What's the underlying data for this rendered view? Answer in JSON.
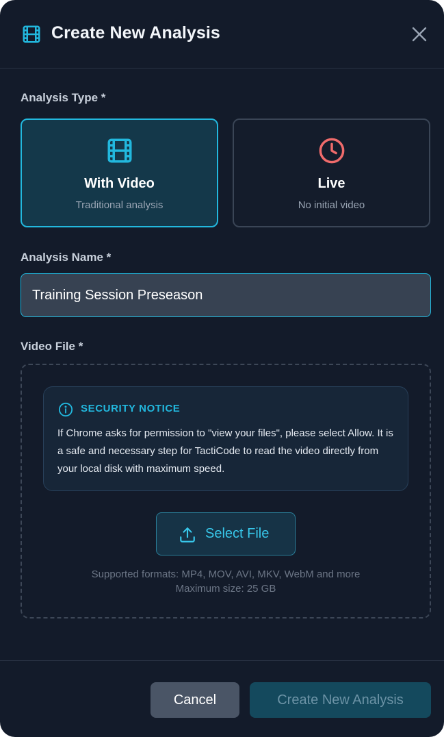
{
  "modal": {
    "title": "Create New Analysis",
    "header_icon": "film-icon",
    "close_icon": "close-icon"
  },
  "analysis_type": {
    "label": "Analysis Type *",
    "selected": "with_video",
    "options": [
      {
        "id": "with_video",
        "icon": "film-icon",
        "title": "With Video",
        "subtitle": "Traditional analysis"
      },
      {
        "id": "live",
        "icon": "clock-icon",
        "title": "Live",
        "subtitle": "No initial video"
      }
    ]
  },
  "analysis_name": {
    "label": "Analysis Name *",
    "value": "Training Session Preseason"
  },
  "video_file": {
    "label": "Video File *",
    "notice": {
      "icon": "info-icon",
      "title": "SECURITY NOTICE",
      "text": "If Chrome asks for permission to \"view your files\", please select Allow. It is a safe and necessary step for TactiCode to read the video directly from your local disk with maximum speed."
    },
    "select_button": {
      "icon": "upload-icon",
      "label": "Select File"
    },
    "formats_line": "Supported formats: MP4, MOV, AVI, MKV, WebM and more",
    "max_size_line": "Maximum size: 25 GB"
  },
  "footer": {
    "cancel_label": "Cancel",
    "create_label": "Create New Analysis"
  },
  "colors": {
    "accent": "#22b8de",
    "live_accent": "#f06b6b",
    "background": "#131b2a"
  }
}
